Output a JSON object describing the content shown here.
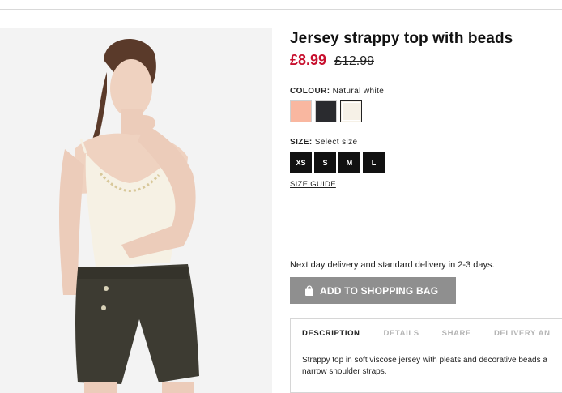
{
  "product": {
    "title": "Jersey strappy top with beads",
    "price_current": "£8.99",
    "price_original": "£12.99"
  },
  "colour": {
    "label": "COLOUR:",
    "selected": "Natural white",
    "swatches": [
      {
        "name": "Peach",
        "hex": "#f9b7a0"
      },
      {
        "name": "Black",
        "hex": "#2a2b2f"
      },
      {
        "name": "Natural white",
        "hex": "#f6f1e7"
      }
    ]
  },
  "size": {
    "label": "SIZE:",
    "prompt": "Select size",
    "options": [
      "XS",
      "S",
      "M",
      "L"
    ],
    "guide_label": "SIZE GUIDE"
  },
  "delivery": {
    "note": "Next day delivery and standard delivery in 2-3 days."
  },
  "cart": {
    "add_label": "ADD TO SHOPPING BAG",
    "icon": "shopping-bag-icon"
  },
  "tabs": {
    "items": [
      "DESCRIPTION",
      "DETAILS",
      "SHARE",
      "DELIVERY AN"
    ],
    "active": "DESCRIPTION",
    "description_lines": [
      "Strappy top in soft viscose jersey with pleats and decorative beads a",
      "narrow shoulder straps."
    ]
  },
  "colors": {
    "sale_red": "#c8102e",
    "button_grey": "#8f8f8f",
    "size_black": "#111111"
  }
}
